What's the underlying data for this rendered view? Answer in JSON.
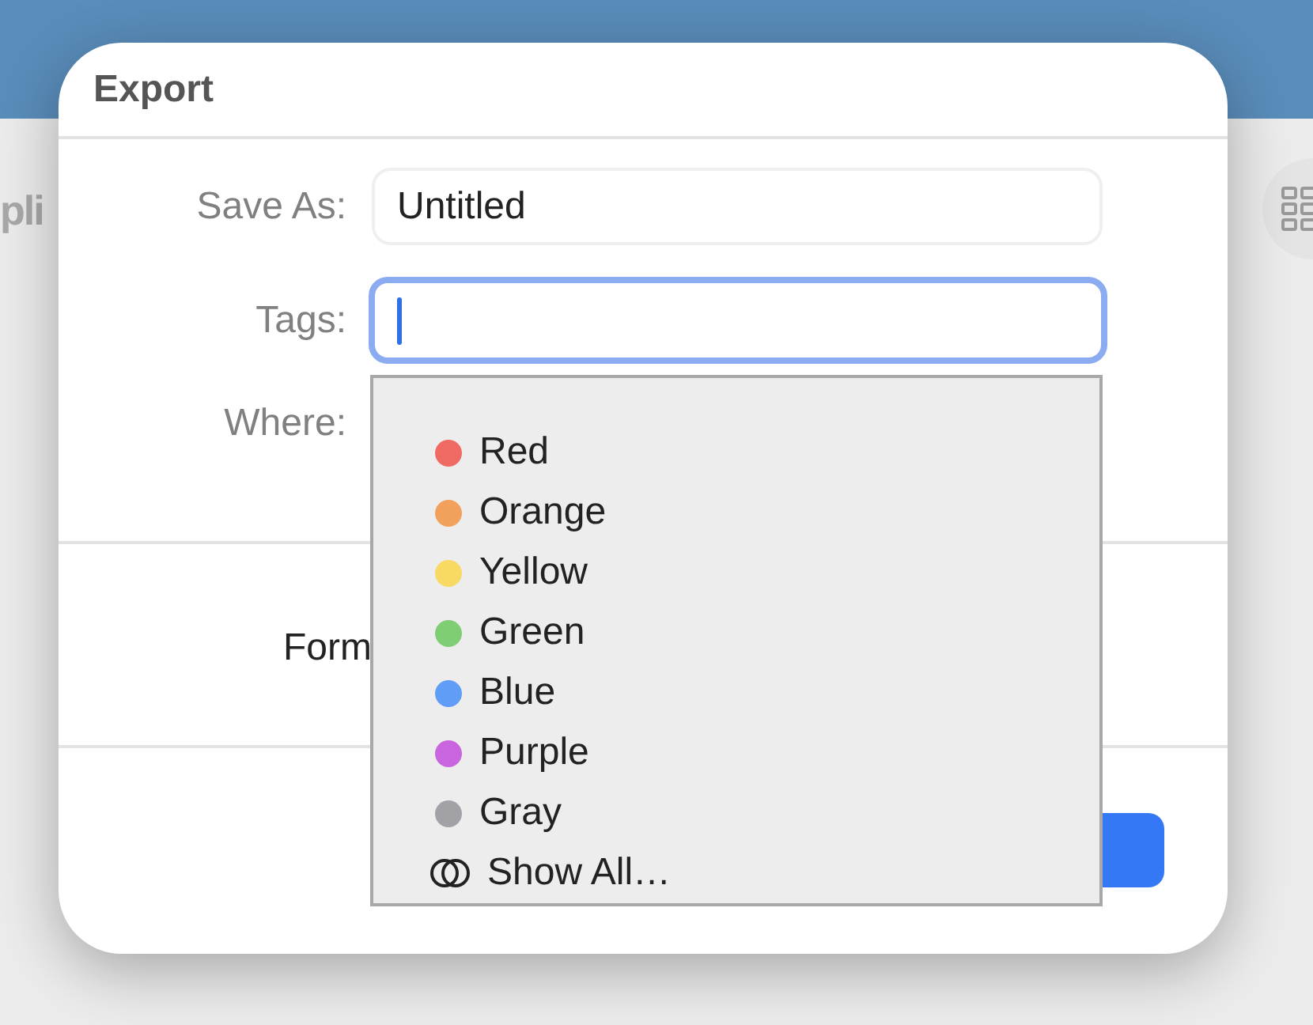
{
  "background": {
    "partial_label": "pli"
  },
  "dialog": {
    "title": "Export",
    "fields": [
      {
        "label": "Save As:",
        "value": "Untitled",
        "focused": false
      },
      {
        "label": "Tags:",
        "focused": true
      }
    ],
    "where_label": "Where:",
    "format_label": "Form"
  },
  "tag_menu": {
    "items": [
      {
        "label": "Red",
        "color": "#ef6a62"
      },
      {
        "label": "Orange",
        "color": "#f2a15c"
      },
      {
        "label": "Yellow",
        "color": "#f8d964"
      },
      {
        "label": "Green",
        "color": "#7fcd75"
      },
      {
        "label": "Blue",
        "color": "#5f9df7"
      },
      {
        "label": "Purple",
        "color": "#c865df"
      },
      {
        "label": "Gray",
        "color": "#a2a2a6"
      }
    ],
    "show_all": "Show All…"
  }
}
